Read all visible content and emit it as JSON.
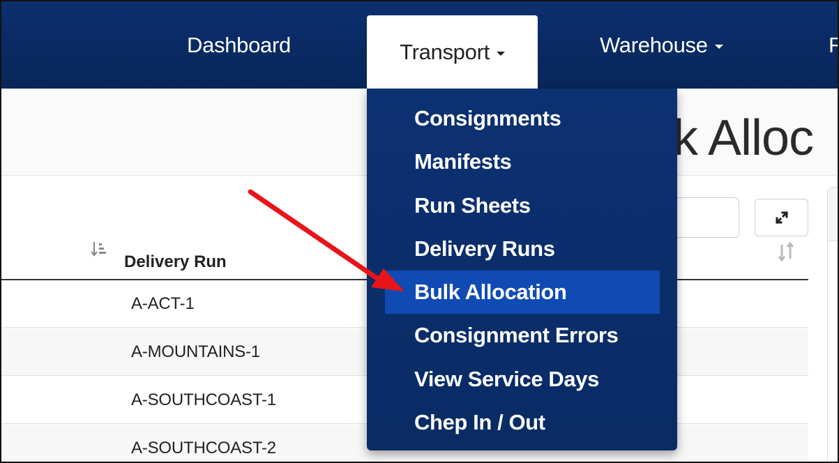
{
  "navbar": {
    "items": [
      {
        "label": "Dashboard"
      },
      {
        "label": "Transport"
      },
      {
        "label": "Warehouse"
      },
      {
        "label": "R"
      }
    ]
  },
  "page": {
    "title_fragment": "lk Alloc"
  },
  "table": {
    "column_header": "Delivery Run",
    "rows": [
      {
        "value": "A-ACT-1"
      },
      {
        "value": "A-MOUNTAINS-1"
      },
      {
        "value": "A-SOUTHCOAST-1"
      },
      {
        "value": "A-SOUTHCOAST-2"
      }
    ]
  },
  "dropdown": {
    "items": [
      {
        "label": "Consignments"
      },
      {
        "label": "Manifests"
      },
      {
        "label": "Run Sheets"
      },
      {
        "label": "Delivery Runs"
      },
      {
        "label": "Bulk Allocation"
      },
      {
        "label": "Consignment Errors"
      },
      {
        "label": "View Service Days"
      },
      {
        "label": "Chep In / Out"
      }
    ],
    "active_label": "Bulk Allocation"
  },
  "colors": {
    "navbar": "#0a2a62",
    "dropdown": "#0b2f6b",
    "active_item": "#0f4bb2",
    "annotation_arrow": "#e8141a"
  },
  "icons": [
    "sort-descending-icon",
    "sort-both-icon",
    "expand-icon",
    "caret-down-icon"
  ]
}
